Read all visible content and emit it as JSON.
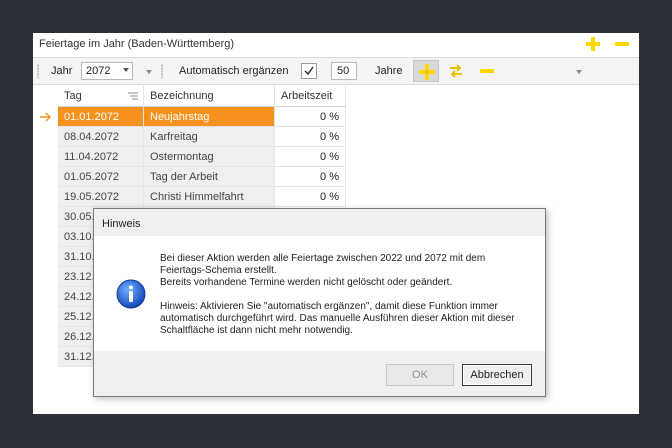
{
  "panel": {
    "title": "Feiertage im Jahr (Baden-Württemberg)"
  },
  "toolbar": {
    "year_label": "Jahr",
    "year_value": "2072",
    "auto_label": "Automatisch ergänzen",
    "auto_checked": true,
    "years_value": "50",
    "years_label": "Jahre"
  },
  "grid": {
    "columns": [
      "Tag",
      "Bezeichnung",
      "Arbeitszeit"
    ],
    "rows": [
      {
        "date": "01.01.2072",
        "name": "Neujahrstag",
        "time": "0 %",
        "selected": true
      },
      {
        "date": "08.04.2072",
        "name": "Karfreitag",
        "time": "0 %"
      },
      {
        "date": "11.04.2072",
        "name": "Ostermontag",
        "time": "0 %"
      },
      {
        "date": "01.05.2072",
        "name": "Tag der Arbeit",
        "time": "0 %"
      },
      {
        "date": "19.05.2072",
        "name": "Christi Himmelfahrt",
        "time": "0 %"
      },
      {
        "date": "30.05.",
        "name": "",
        "time": ""
      },
      {
        "date": "03.10.",
        "name": "",
        "time": ""
      },
      {
        "date": "31.10.",
        "name": "",
        "time": ""
      },
      {
        "date": "23.12.",
        "name": "",
        "time": ""
      },
      {
        "date": "24.12.",
        "name": "",
        "time": ""
      },
      {
        "date": "25.12.",
        "name": "",
        "time": ""
      },
      {
        "date": "26.12.",
        "name": "",
        "time": ""
      },
      {
        "date": "31.12.",
        "name": "",
        "time": ""
      }
    ]
  },
  "dialog": {
    "title": "Hinweis",
    "line1": "Bei dieser Aktion werden alle Feiertage zwischen 2022 und 2072 mit dem",
    "line2": "Feiertags-Schema erstellt.",
    "line3": "Bereits vorhandene Termine werden nicht gelöscht oder geändert.",
    "line4": "Hinweis: Aktivieren Sie \"automatisch ergänzen\", damit diese Funktion immer",
    "line5": "automatisch durchgeführt wird. Das manuelle Ausführen dieser Aktion mit dieser",
    "line6": "Schaltfläche ist dann nicht mehr notwendig.",
    "ok_label": "OK",
    "cancel_label": "Abbrechen"
  },
  "colors": {
    "accent": "#f4921d",
    "icon_yellow": "#ffd800",
    "background": "#2e3038"
  }
}
